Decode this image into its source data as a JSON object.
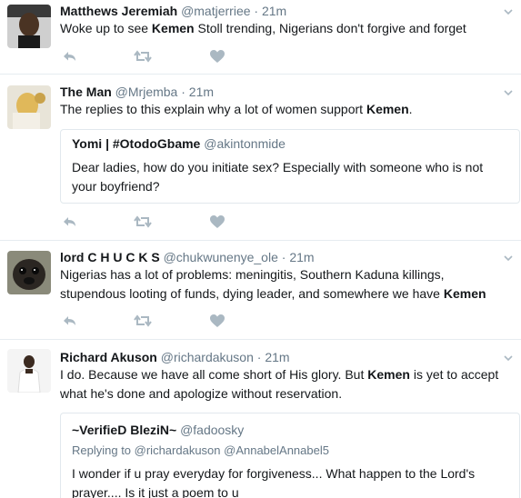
{
  "tweets": [
    {
      "name": "Matthews Jeremiah",
      "handle": "@matjerriee",
      "dot": "·",
      "time": "21m",
      "text_before": "Woke up to see ",
      "text_bold": "Kemen",
      "text_after": " Stoll trending, Nigerians don't forgive and forget"
    },
    {
      "name": "The Man",
      "handle": "@Mrjemba",
      "dot": "·",
      "time": "21m",
      "text_before": "The replies to this explain why a lot of women support ",
      "text_bold": "Kemen",
      "text_after": ".",
      "quote": {
        "name": "Yomi | #OtodoGbame",
        "handle": "@akintonmide",
        "text": "Dear ladies, how do you initiate sex?  Especially with someone who is not your boyfriend?"
      }
    },
    {
      "name": "lord C H U C K S",
      "handle": "@chukwunenye_ole",
      "dot": "·",
      "time": "21m",
      "text_before": "Nigerias has a lot of problems: meningitis, Southern Kaduna killings, stupendous looting of funds, dying leader, and somewhere we have ",
      "text_bold": "Kemen",
      "text_after": ""
    },
    {
      "name": "Richard Akuson",
      "handle": "@richardakuson",
      "dot": "·",
      "time": "21m",
      "text_before": "I do. Because we have all come short of His glory. But ",
      "text_bold": "Kemen",
      "text_after": " is yet to accept what he's done and apologize without reservation.",
      "quote": {
        "name": "~VerifieD BleziN~",
        "handle": "@fadoosky",
        "replying_prefix": "Replying to ",
        "replying_to": "@richardakuson @AnnabelAnnabel5",
        "text": "I wonder if u pray everyday for forgiveness...  What happen to the Lord's prayer.... Is it just a poem to u"
      }
    }
  ],
  "icons": {
    "reply": "reply-icon",
    "retweet": "retweet-icon",
    "like": "heart-icon",
    "caret": "chevron-down-icon"
  },
  "colors": {
    "icon_gray": "#aab8c2",
    "muted_text": "#657786",
    "border": "#e6ecf0"
  }
}
